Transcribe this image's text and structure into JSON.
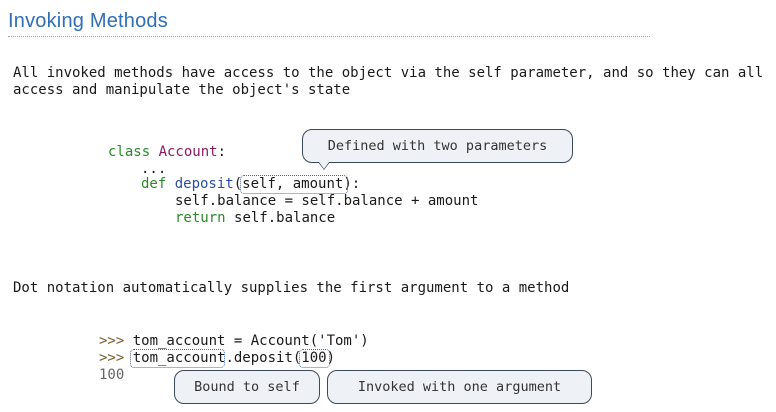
{
  "title": "Invoking Methods",
  "intro_line1": "All invoked methods have access to the object via the self parameter, and so they can all",
  "intro_line2": "access and manipulate the object's state",
  "code1": {
    "class_kw": "class ",
    "class_name": "Account",
    "class_colon": ":",
    "ellipsis": "...",
    "def_kw": "def ",
    "def_name": "deposit",
    "def_open": "(",
    "param_self": "self",
    "param_sep": ", ",
    "param_amount": "amount",
    "def_close": "):",
    "line3": "self.balance = self.balance + amount",
    "ret_kw": "return ",
    "ret_rest": "self.balance"
  },
  "callout_defined": "Defined with two parameters",
  "dot_notation_line": "Dot notation automatically supplies the first argument to a method",
  "repl": {
    "prompt1": ">>> ",
    "line1": "tom_account = Account('Tom')",
    "prompt2": ">>> ",
    "obj": "tom_account",
    "method": ".deposit(",
    "arg": "100",
    "close": ")",
    "output": "100"
  },
  "callout_bound": "Bound to self",
  "callout_invoked": "Invoked with one argument"
}
